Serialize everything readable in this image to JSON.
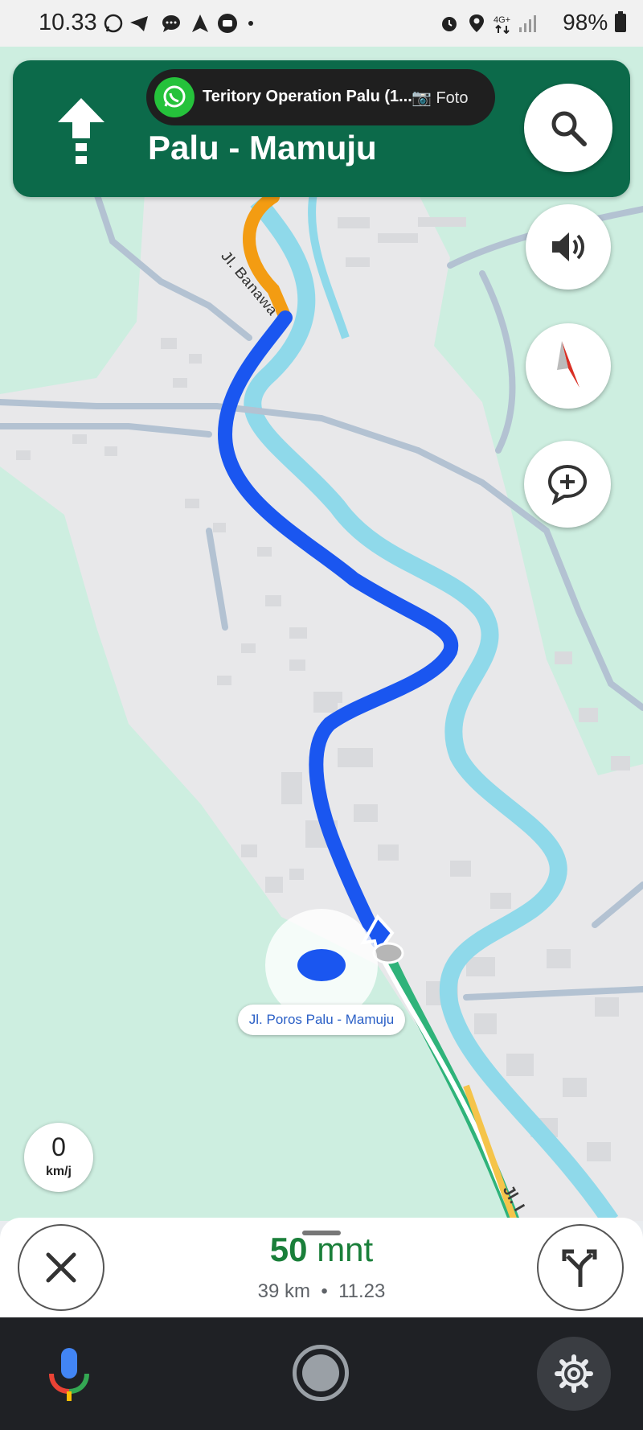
{
  "status_bar": {
    "time": "10.33",
    "battery": "98%",
    "icons": [
      "whatsapp-icon",
      "telegram-icon",
      "messages-icon",
      "navigation-icon",
      "chat-icon",
      "dot-icon",
      "alarm-icon",
      "location-icon",
      "4g-icon",
      "signal-icon",
      "battery-icon"
    ]
  },
  "navigation": {
    "turn_direction": "straight",
    "street": "Palu - Mamuju"
  },
  "notification": {
    "app": "WhatsApp",
    "title": "Teritory Operation Palu (1...",
    "preview": "📷 Foto"
  },
  "map": {
    "street_labels": {
      "banawa": "Jl. Banawa",
      "bottom": "Jl. I"
    },
    "current_road": "Jl. Poros Palu - Mamuju",
    "colors": {
      "route": "#1a56f0",
      "traffic_slow": "#f39c12",
      "green_road": "#2fb37a",
      "yellow_road": "#f5c44a",
      "river": "#8fd9ea",
      "land": "#cdeee0",
      "urban": "#e8e8ea"
    }
  },
  "speed": {
    "value": "0",
    "unit": "km/j"
  },
  "trip": {
    "duration_value": "50",
    "duration_unit": "mnt",
    "distance": "39 km",
    "separator": "•",
    "arrival": "11.23"
  },
  "buttons": {
    "search": "search-icon",
    "sound": "volume-icon",
    "compass": "compass-icon",
    "report": "add-report-icon",
    "close": "close-icon",
    "alternate_routes": "alternate-routes-icon",
    "mic": "mic-icon",
    "settings": "gear-icon"
  }
}
